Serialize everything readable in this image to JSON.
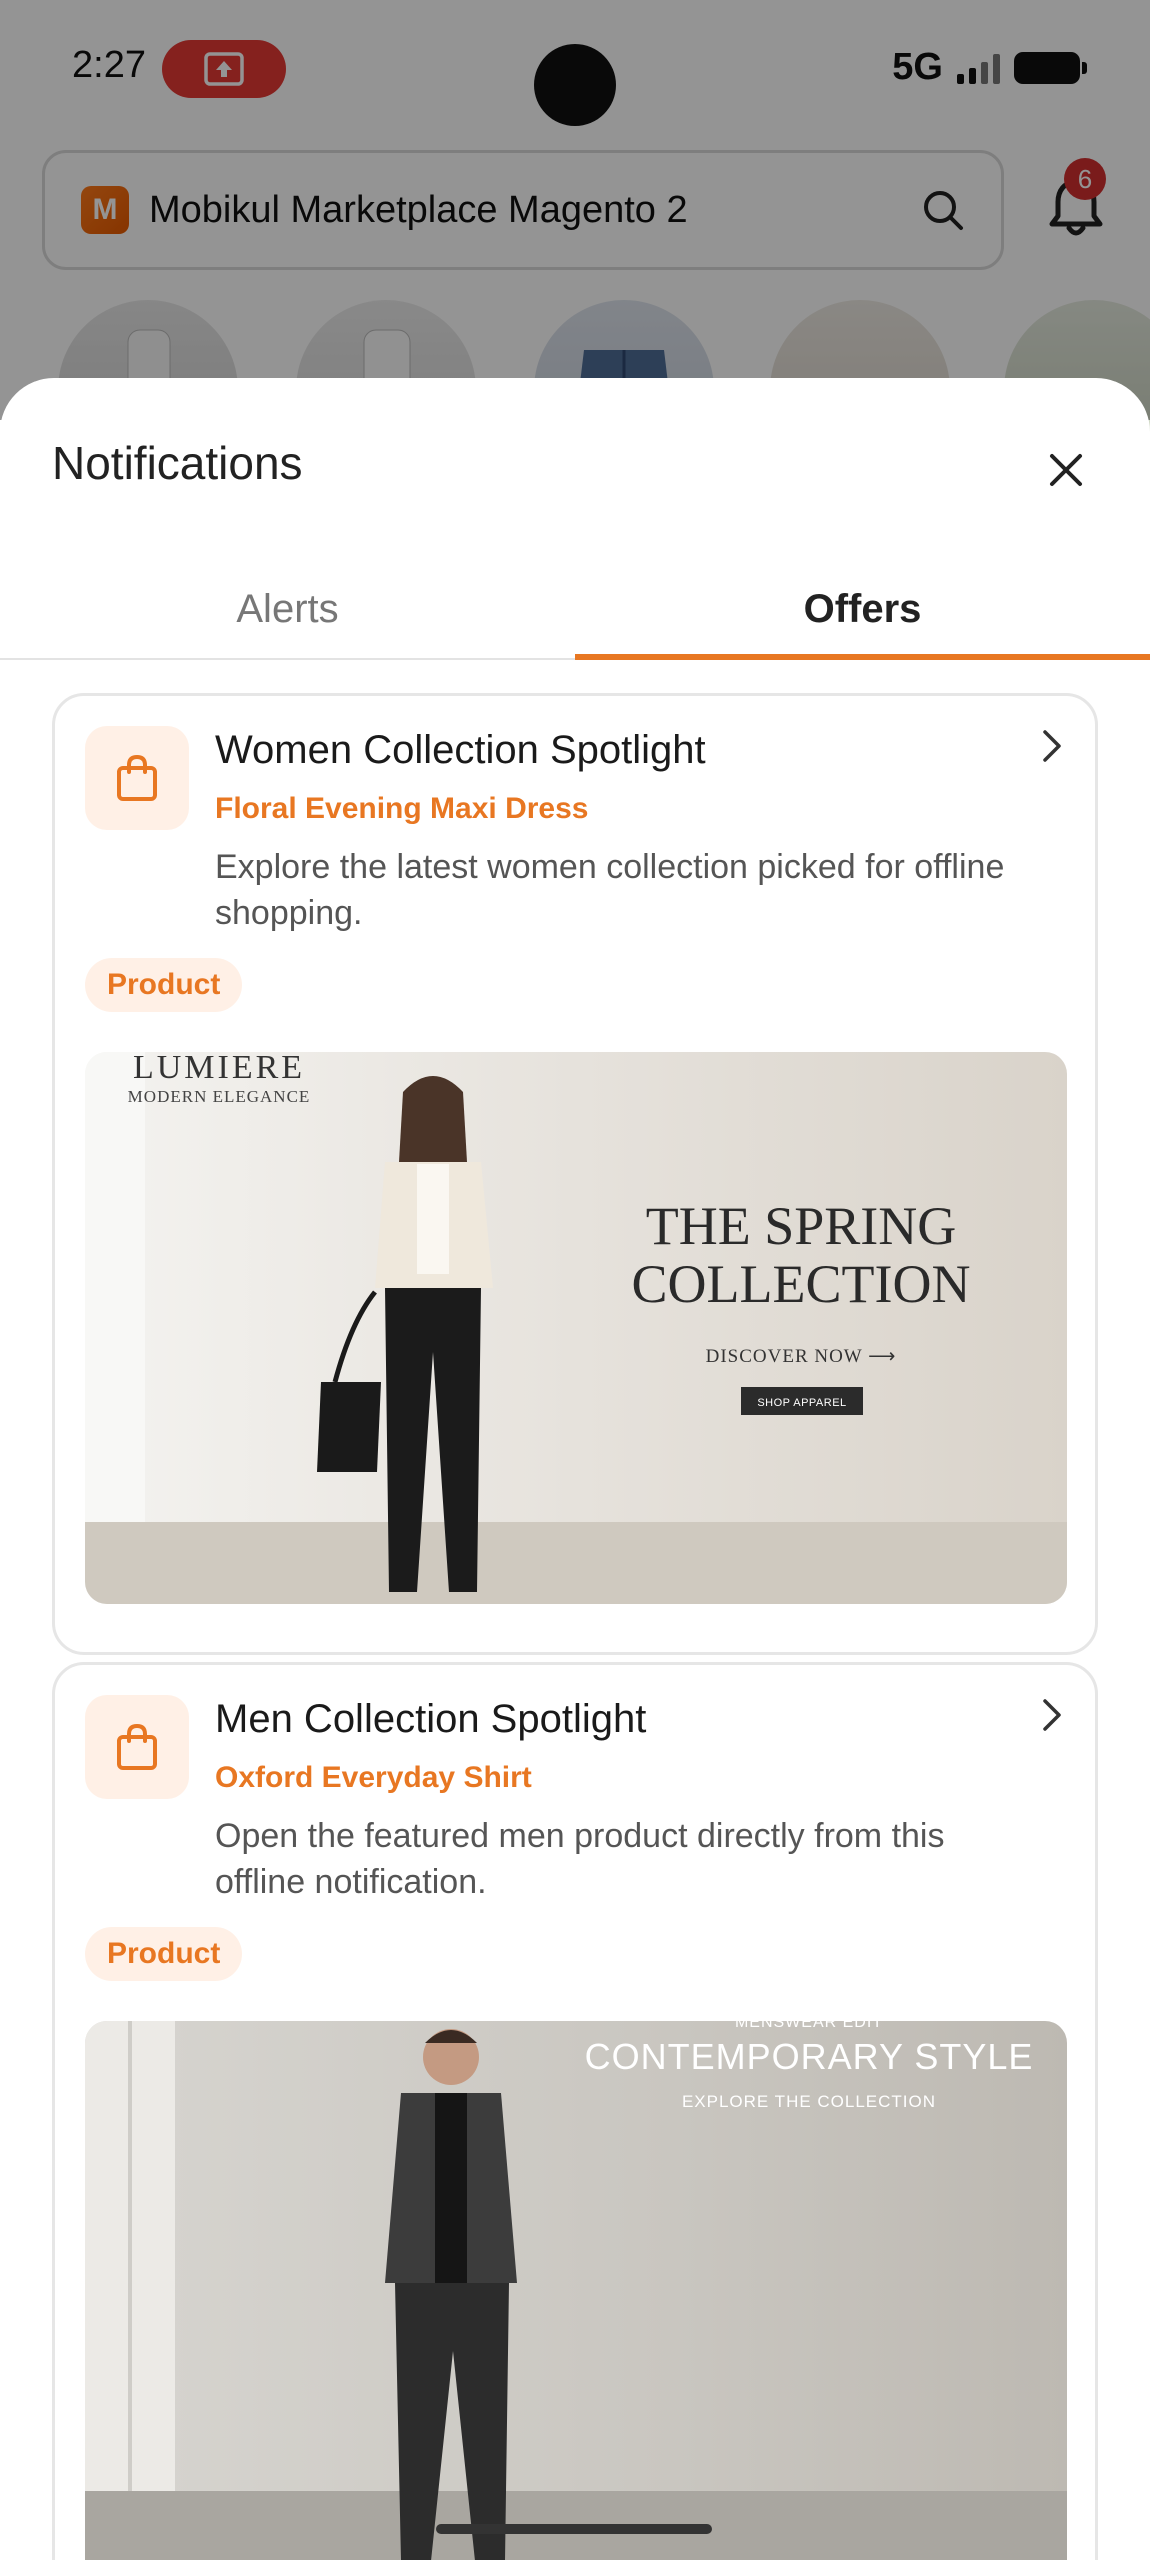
{
  "status_bar": {
    "time": "2:27",
    "network": "5G"
  },
  "app_bar": {
    "title": "Mobikul Marketplace Magento 2",
    "notification_count": "6"
  },
  "sheet": {
    "title": "Notifications",
    "tabs": [
      {
        "label": "Alerts",
        "selected": false
      },
      {
        "label": "Offers",
        "selected": true
      }
    ]
  },
  "offers": [
    {
      "title": "Women Collection Spotlight",
      "subtitle": "Floral Evening Maxi Dress",
      "description": "Explore the latest women collection picked for offline shopping.",
      "tag": "Product",
      "banner": {
        "brand": "LUMIERE",
        "tagline": "MODERN ELEGANCE",
        "headline_1": "THE SPRING",
        "headline_2": "COLLECTION",
        "cta": "DISCOVER NOW ⟶",
        "button": "SHOP APPAREL"
      }
    },
    {
      "title": "Men Collection Spotlight",
      "subtitle": "Oxford Everyday Shirt",
      "description": "Open the featured men product directly from this offline notification.",
      "tag": "Product",
      "banner": {
        "kicker": "MENSWEAR EDIT",
        "headline": "CONTEMPORARY STYLE",
        "cta": "EXPLORE THE COLLECTION"
      }
    }
  ],
  "colors": {
    "accent": "#e87722",
    "accent_tint": "#fff0e6",
    "badge": "#d32f2f"
  },
  "icons": [
    "screen-record-icon",
    "search-icon",
    "bell-icon",
    "close-icon",
    "shopping-bag-icon",
    "chevron-right-icon"
  ]
}
